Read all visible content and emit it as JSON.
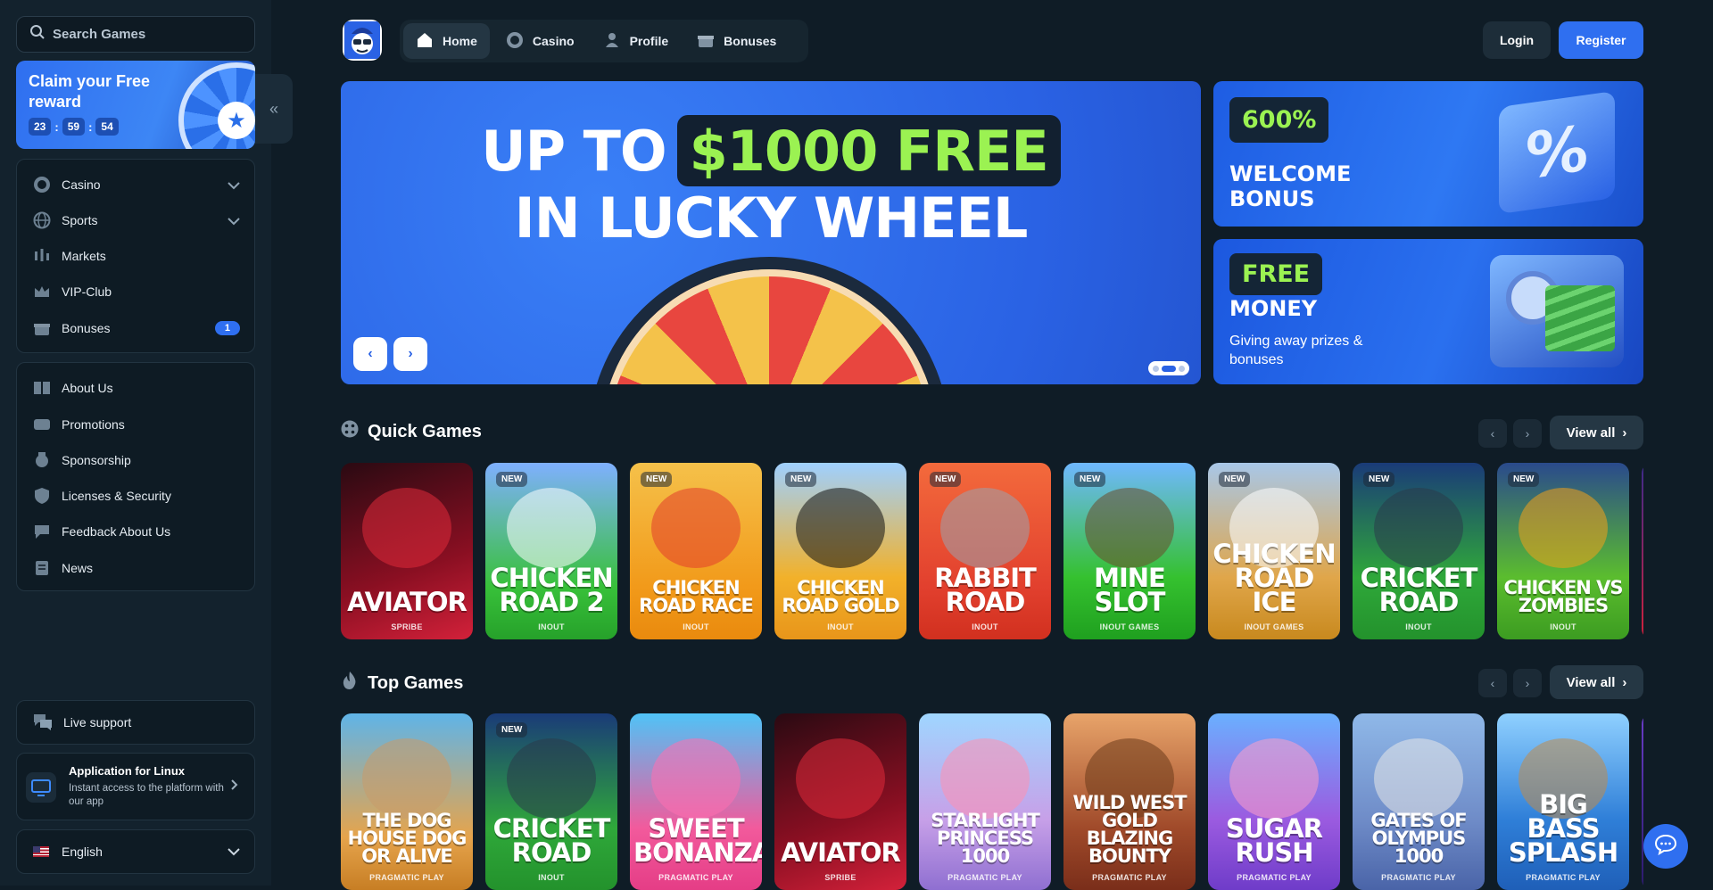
{
  "sidebar": {
    "search_placeholder": "Search Games",
    "reward": {
      "title": "Claim your Free reward",
      "timer": [
        "23",
        "59",
        "54"
      ]
    },
    "main_items": [
      {
        "label": "Casino",
        "icon": "casino-chip-icon",
        "expandable": true
      },
      {
        "label": "Sports",
        "icon": "globe-icon",
        "expandable": true
      },
      {
        "label": "Markets",
        "icon": "candlestick-chart-icon"
      },
      {
        "label": "VIP-Club",
        "icon": "crown-icon"
      },
      {
        "label": "Bonuses",
        "icon": "gift-icon",
        "badge": "1"
      }
    ],
    "info_items": [
      {
        "label": "About Us",
        "icon": "book-icon"
      },
      {
        "label": "Promotions",
        "icon": "tickets-icon"
      },
      {
        "label": "Sponsorship",
        "icon": "medal-icon"
      },
      {
        "label": "Licenses & Security",
        "icon": "shield-icon"
      },
      {
        "label": "Feedback About Us",
        "icon": "feedback-icon"
      },
      {
        "label": "News",
        "icon": "newspaper-icon"
      }
    ],
    "support": "Live support",
    "app": {
      "title": "Application for Linux",
      "subtitle": "Instant access to the platform with our app"
    },
    "language": "English"
  },
  "topnav": {
    "tabs": [
      {
        "label": "Home",
        "icon": "home-icon",
        "active": true
      },
      {
        "label": "Casino",
        "icon": "casino-chip-icon"
      },
      {
        "label": "Profile",
        "icon": "user-icon"
      },
      {
        "label": "Bonuses",
        "icon": "gift-icon"
      }
    ],
    "login": "Login",
    "register": "Register"
  },
  "hero": {
    "line1_prefix": "UP TO",
    "line1_highlight": "$1000 FREE",
    "line2": "IN LUCKY WHEEL",
    "slides": 3,
    "active_slide": 2
  },
  "promos": [
    {
      "tag": "600%",
      "title": "WELCOME BONUS"
    },
    {
      "tag": "FREE",
      "title": "MONEY",
      "subtitle": "Giving away prizes & bonuses"
    }
  ],
  "sections": [
    {
      "title": "Quick Games",
      "icon": "dice-icon",
      "view_all": "View all",
      "games": [
        {
          "name": "AVIATOR",
          "provider": "SPRIBE",
          "new": false
        },
        {
          "name": "CHICKEN ROAD 2",
          "provider": "INOUT",
          "new": true
        },
        {
          "name": "CHICKEN ROAD RACE",
          "provider": "INOUT",
          "new": true
        },
        {
          "name": "CHICKEN ROAD GOLD",
          "provider": "INOUT",
          "new": true
        },
        {
          "name": "RABBIT ROAD",
          "provider": "INOUT",
          "new": true
        },
        {
          "name": "MINE SLOT",
          "provider": "INOUT GAMES",
          "new": true
        },
        {
          "name": "CHICKEN ROAD ICE",
          "provider": "INOUT GAMES",
          "new": true
        },
        {
          "name": "CRICKET ROAD",
          "provider": "INOUT",
          "new": true
        },
        {
          "name": "CHICKEN VS ZOMBIES",
          "provider": "INOUT",
          "new": true
        }
      ]
    },
    {
      "title": "Top Games",
      "icon": "flame-icon",
      "view_all": "View all",
      "games": [
        {
          "name": "THE DOG HOUSE DOG OR ALIVE",
          "provider": "PRAGMATIC PLAY",
          "new": false
        },
        {
          "name": "CRICKET ROAD",
          "provider": "INOUT",
          "new": true
        },
        {
          "name": "SWEET BONANZA",
          "provider": "PRAGMATIC PLAY",
          "new": false
        },
        {
          "name": "AVIATOR",
          "provider": "SPRIBE",
          "new": false
        },
        {
          "name": "STARLIGHT PRINCESS 1000",
          "provider": "PRAGMATIC PLAY",
          "new": false
        },
        {
          "name": "WILD WEST GOLD BLAZING BOUNTY",
          "provider": "PRAGMATIC PLAY",
          "new": false
        },
        {
          "name": "SUGAR RUSH",
          "provider": "PRAGMATIC PLAY",
          "new": false
        },
        {
          "name": "GATES OF OLYMPUS 1000",
          "provider": "PRAGMATIC PLAY",
          "new": false
        },
        {
          "name": "BIG BASS SPLASH",
          "provider": "PRAGMATIC PLAY",
          "new": false
        }
      ]
    }
  ],
  "badge_label": "NEW",
  "colors": {
    "accent": "#2f6ff0",
    "highlight": "#9bf252",
    "background": "#0f1c26"
  }
}
